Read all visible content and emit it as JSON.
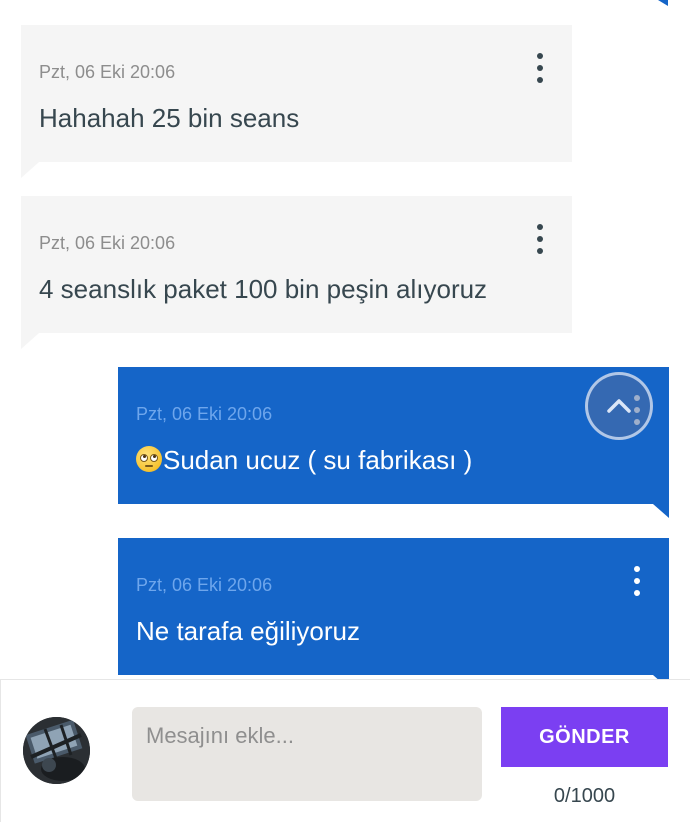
{
  "messages": [
    {
      "direction": "incoming",
      "time": "Pzt, 06 Eki 20:06",
      "text": "Hahahah 25 bin seans"
    },
    {
      "direction": "incoming",
      "time": "Pzt, 06 Eki 20:06",
      "text": "4 seanslık paket 100 bin peşin alıyoruz"
    },
    {
      "direction": "outgoing",
      "time": "Pzt, 06 Eki 20:06",
      "emoji": "face-with-rolling-eyes",
      "text": "Sudan ucuz ( su fabrikası )"
    },
    {
      "direction": "outgoing",
      "time": "Pzt, 06 Eki 20:06",
      "text": "Ne tarafa eğiliyoruz"
    }
  ],
  "composer": {
    "placeholder": "Mesajını ekle...",
    "value": "",
    "send_label": "GÖNDER",
    "counter": "0/1000"
  },
  "icons": {
    "message_menu": "more-vertical-icon",
    "scroll_top": "chevron-up-icon",
    "avatar": "user-avatar"
  },
  "colors": {
    "incoming_bubble": "#f5f5f5",
    "outgoing_bubble": "#1565c8",
    "send_button": "#7b3ff2",
    "input_background": "#e8e6e3"
  }
}
